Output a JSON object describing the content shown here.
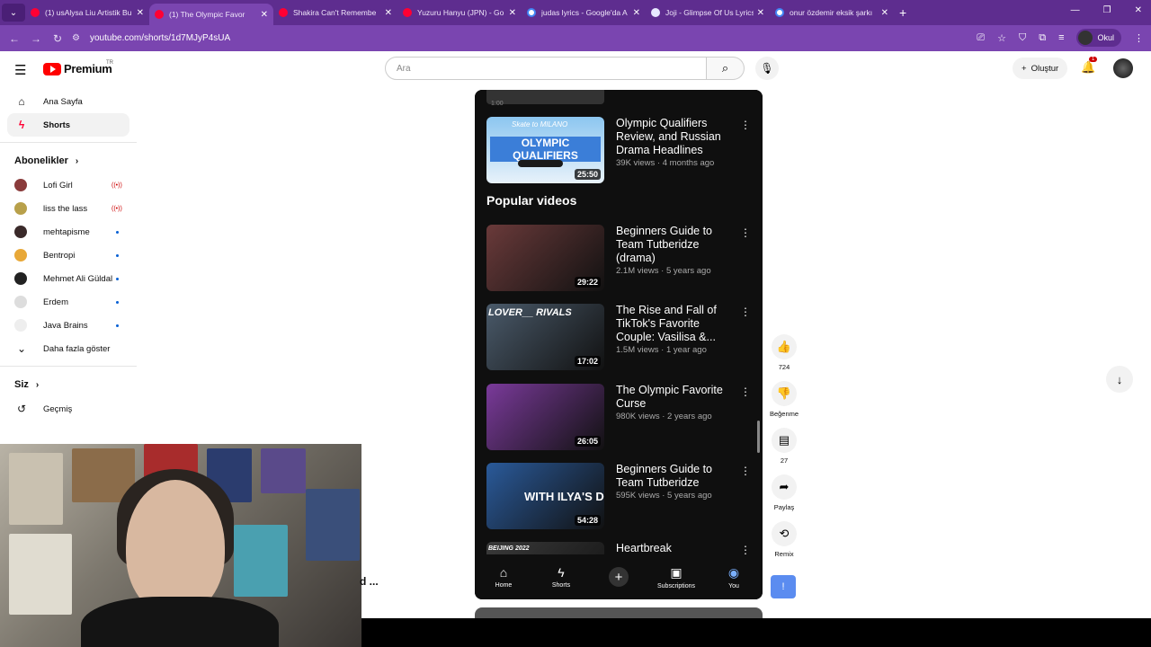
{
  "browser": {
    "tabs": [
      {
        "title": "(1) usAlysa Liu Artistik Bu",
        "icon": "youtube",
        "active": false
      },
      {
        "title": "(1) The Olympic Favor",
        "icon": "youtube",
        "active": true
      },
      {
        "title": "Shakira Can't Remembe",
        "icon": "youtube",
        "active": false
      },
      {
        "title": "Yuzuru Hanyu (JPN) - Go",
        "icon": "youtube",
        "active": false
      },
      {
        "title": "judas lyrics - Google'da A",
        "icon": "google",
        "active": false
      },
      {
        "title": "Joji - Glimpse Of Us Lyrics",
        "icon": "genius",
        "active": false
      },
      {
        "title": "onur özdemir eksik şarkı",
        "icon": "google",
        "active": false
      }
    ],
    "url": "youtube.com/shorts/1d7MJyP4sUA",
    "profile_name": "Okul"
  },
  "header": {
    "logo_text": "Premium",
    "region": "TR",
    "search_placeholder": "Ara",
    "create_label": "Oluştur",
    "notification_count": "1"
  },
  "sidebar": {
    "items": [
      {
        "label": "Ana Sayfa",
        "icon": "home-icon"
      },
      {
        "label": "Shorts",
        "icon": "shorts-icon"
      }
    ],
    "subscriptions_title": "Abonelikler",
    "subscriptions": [
      {
        "name": "Lofi Girl",
        "indicator": "live",
        "color": "#8a3b3b"
      },
      {
        "name": "liss the lass",
        "indicator": "live",
        "color": "#b8a04a"
      },
      {
        "name": "mehtapisme",
        "indicator": "dot",
        "color": "#3a2a2a"
      },
      {
        "name": "Bentropi",
        "indicator": "dot",
        "color": "#e8a838"
      },
      {
        "name": "Mehmet Ali Güldal",
        "indicator": "dot",
        "color": "#222222"
      },
      {
        "name": "Erdem",
        "indicator": "dot",
        "color": "#dddddd"
      },
      {
        "name": "Java Brains",
        "indicator": "dot",
        "color": "#eeeeee"
      }
    ],
    "show_more_label": "Daha fazla göster",
    "you_title": "Siz",
    "history_label": "Geçmiş"
  },
  "phone": {
    "top_duration": "1:00",
    "videos_top": [
      {
        "title": "Olympic Qualifiers Review, and Russian Drama Headlines",
        "meta": "39K views · 4 months ago",
        "duration": "25:50",
        "thumb_color": "#6ab0e8"
      }
    ],
    "section_title": "Popular videos",
    "videos": [
      {
        "title": "Beginners Guide to Team Tutberidze (drama)",
        "meta": "2.1M views · 5 years ago",
        "duration": "29:22",
        "thumb_color": "#6a3a3a"
      },
      {
        "title": "The Rise and Fall of TikTok's Favorite Couple: Vasilisa &...",
        "meta": "1.5M views · 1 year ago",
        "duration": "17:02",
        "thumb_color": "#4a5a6a"
      },
      {
        "title": "The Olympic Favorite Curse",
        "meta": "980K views · 2 years ago",
        "duration": "26:05",
        "thumb_color": "#7a3a9a"
      },
      {
        "title": "Beginners Guide to Team Tutberidze",
        "meta": "595K views · 5 years ago",
        "duration": "54:28",
        "thumb_color": "#2a5a9a"
      },
      {
        "title": "Heartbreak",
        "meta": "",
        "duration": "",
        "thumb_color": "#3a3a3a"
      }
    ],
    "thumb_overlays": {
      "olympic_qualifiers": "OLYMPIC QUALIFIERS",
      "milano": "Skate to MILANO",
      "lovers_rivals": "LOVER__ RIVALS",
      "disastrous": "WITH ILYA'S DISASTROUS ...",
      "beijing": "BEIJING 2022"
    },
    "nav": [
      {
        "label": "Home",
        "icon": "home-icon"
      },
      {
        "label": "Shorts",
        "icon": "shorts-icon"
      },
      {
        "label": "",
        "icon": "plus-icon"
      },
      {
        "label": "Subscriptions",
        "icon": "subscriptions-icon"
      },
      {
        "label": "You",
        "icon": "you-icon"
      }
    ]
  },
  "actions": {
    "like_count": "724",
    "dislike_label": "Beğenme",
    "comment_count": "27",
    "share_label": "Paylaş",
    "remix_label": "Remix"
  },
  "overlay_caption": "d ..."
}
